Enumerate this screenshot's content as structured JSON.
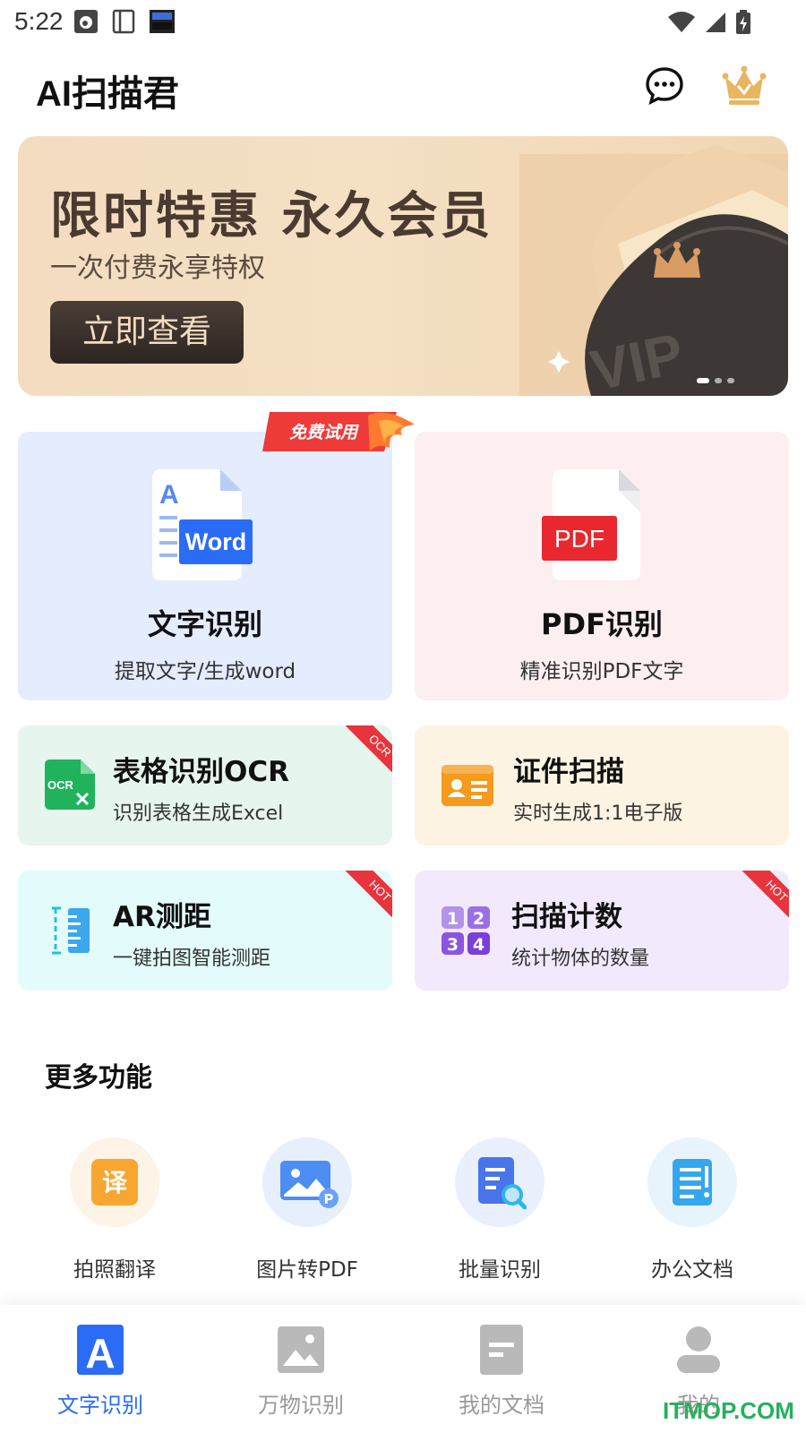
{
  "status_bar": {
    "time": "5:22"
  },
  "header": {
    "title": "AI扫描君"
  },
  "banner": {
    "title": "限时特惠 永久会员",
    "subtitle": "一次付费永享特权",
    "button": "立即查看",
    "art_text": "VIP",
    "dots": 3,
    "active_dot": 0
  },
  "main_cards": [
    {
      "title": "文字识别",
      "subtitle": "提取文字/生成word",
      "icon_text": "Word",
      "icon_letter": "A",
      "tag": "免费试用"
    },
    {
      "title": "PDF识别",
      "subtitle": "精准识别PDF文字",
      "icon_text": "PDF"
    }
  ],
  "tools": [
    {
      "title": "表格识别OCR",
      "subtitle": "识别表格生成Excel",
      "icon_text": "OCR",
      "corner": "OCR"
    },
    {
      "title": "证件扫描",
      "subtitle": "实时生成1:1电子版"
    },
    {
      "title": "AR测距",
      "subtitle": "一键拍图智能测距",
      "corner": "HOT"
    },
    {
      "title": "扫描计数",
      "subtitle": "统计物体的数量",
      "icon_digits": [
        "1",
        "2",
        "3",
        "4"
      ],
      "corner": "HOT"
    }
  ],
  "more": {
    "title": "更多功能",
    "items": [
      {
        "label": "拍照翻译",
        "icon_text": "译"
      },
      {
        "label": "图片转PDF",
        "icon_text": "P"
      },
      {
        "label": "批量识别"
      },
      {
        "label": "办公文档"
      }
    ]
  },
  "nav": {
    "items": [
      {
        "label": "文字识别",
        "icon_text": "A"
      },
      {
        "label": "万物识别"
      },
      {
        "label": "我的文档"
      },
      {
        "label": "我的"
      }
    ],
    "active": 0
  },
  "watermark": "ITMOP.COM",
  "colors": {
    "accent": "#2a6cf6",
    "hot": "#e8343c",
    "pdf_red": "#e8282e",
    "excel_green": "#21b35b",
    "id_orange": "#f59a1c"
  }
}
